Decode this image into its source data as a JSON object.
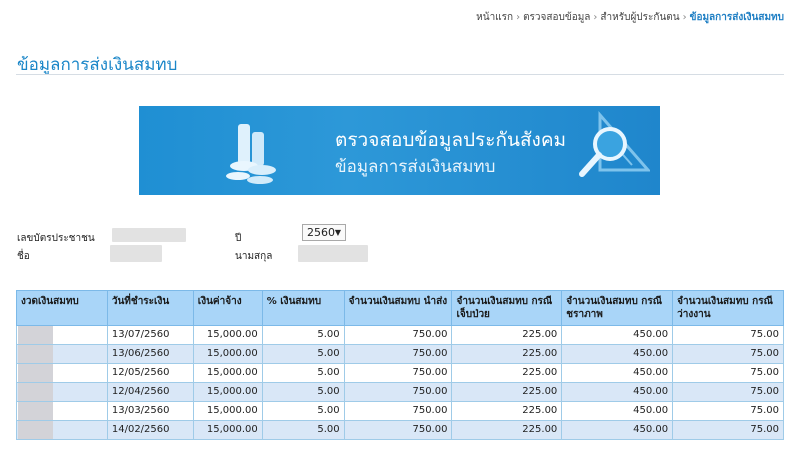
{
  "breadcrumb": {
    "items": [
      "หน้าแรก",
      "ตรวจสอบข้อมูล",
      "สำหรับผู้ประกันตน"
    ],
    "current": "ข้อมูลการส่งเงินสมทบ"
  },
  "page": {
    "title": "ข้อมูลการส่งเงินสมทบ"
  },
  "banner": {
    "line1": "ตรวจสอบข้อมูลประกันสังคม",
    "line2": "ข้อมูลการส่งเงินสมทบ"
  },
  "form": {
    "id_label": "เลขบัตรประชาชน",
    "name_label": "ชื่อ",
    "year_label": "ปี",
    "year_value": "2560",
    "surname_label": "นามสกุล"
  },
  "table": {
    "headers": [
      "งวดเงินสมทบ",
      "วันที่ชำระเงิน",
      "เงินค่าจ้าง",
      "% เงินสมทบ",
      "จำนวนเงินสมทบ นำส่ง",
      "จำนวนเงินสมทบ กรณีเจ็บป่วย",
      "จำนวนเงินสมทบ กรณีชราภาพ",
      "จำนวนเงินสมทบ กรณีว่างงาน"
    ],
    "rows": [
      {
        "date": "13/07/2560",
        "wage": "15,000.00",
        "pct": "5.00",
        "total": "750.00",
        "sick": "225.00",
        "old_age": "450.00",
        "unemployment": "75.00"
      },
      {
        "date": "13/06/2560",
        "wage": "15,000.00",
        "pct": "5.00",
        "total": "750.00",
        "sick": "225.00",
        "old_age": "450.00",
        "unemployment": "75.00"
      },
      {
        "date": "12/05/2560",
        "wage": "15,000.00",
        "pct": "5.00",
        "total": "750.00",
        "sick": "225.00",
        "old_age": "450.00",
        "unemployment": "75.00"
      },
      {
        "date": "12/04/2560",
        "wage": "15,000.00",
        "pct": "5.00",
        "total": "750.00",
        "sick": "225.00",
        "old_age": "450.00",
        "unemployment": "75.00"
      },
      {
        "date": "13/03/2560",
        "wage": "15,000.00",
        "pct": "5.00",
        "total": "750.00",
        "sick": "225.00",
        "old_age": "450.00",
        "unemployment": "75.00"
      },
      {
        "date": "14/02/2560",
        "wage": "15,000.00",
        "pct": "5.00",
        "total": "750.00",
        "sick": "225.00",
        "old_age": "450.00",
        "unemployment": "75.00"
      }
    ]
  }
}
